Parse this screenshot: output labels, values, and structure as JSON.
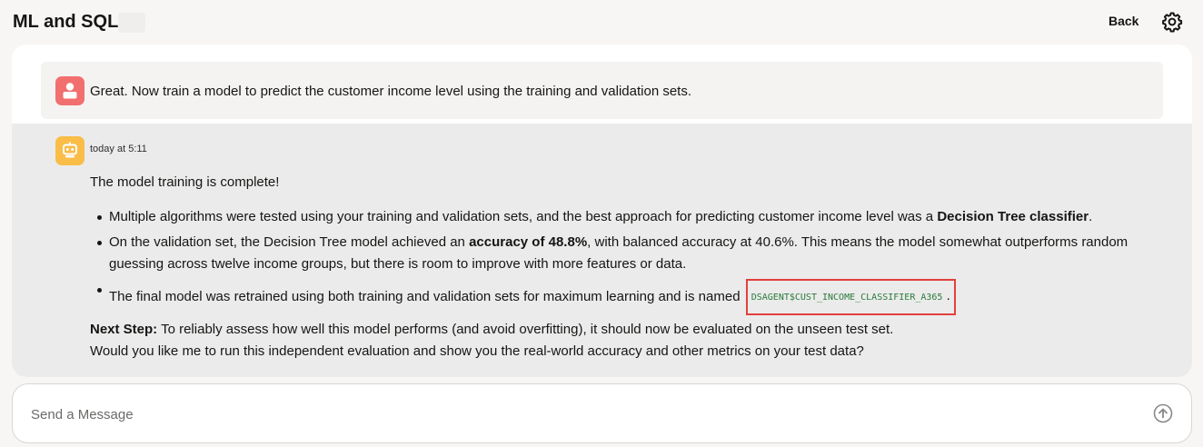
{
  "header": {
    "title": "ML and SQL",
    "back_label": "Back",
    "settings_icon": "gear-icon"
  },
  "user_message": {
    "avatar_icon": "user-icon",
    "avatar_color": "#f26f6f",
    "text": "Great. Now train a model to predict the customer income level using the training and validation sets."
  },
  "agent_message": {
    "avatar_icon": "robot-icon",
    "avatar_color": "#f9bd48",
    "timestamp": "today at 5:11",
    "intro": "The model training is complete!",
    "bullet1_pre": "Multiple algorithms were tested using your training and validation sets, and the best approach for predicting customer income level was a ",
    "bullet1_bold": "Decision Tree classifier",
    "bullet1_post": ".",
    "bullet2_pre": "On the validation set, the Decision Tree model achieved an ",
    "bullet2_bold": "accuracy of 48.8%",
    "bullet2_post": ", with balanced accuracy at 40.6%. This means the model somewhat outperforms random guessing across twelve income groups, but there is room to improve with more features or data.",
    "bullet3_pre": "The final model was retrained using both training and validation sets for maximum learning and is named ",
    "bullet3_code": "DSAGENT$CUST_INCOME_CLASSIFIER_A365",
    "bullet3_post": ".",
    "next_step_label": "Next Step:",
    "next_step_text": " To reliably assess how well this model performs (and avoid overfitting), it should now be evaluated on the unseen test set.",
    "followup": "Would you like me to run this independent evaluation and show you the real-world accuracy and other metrics on your test data?"
  },
  "composer": {
    "placeholder": "Send a Message",
    "send_icon": "send-arrow-up-icon"
  },
  "colors": {
    "highlight_border": "#e2403d",
    "code_text": "#2a7a3a"
  }
}
